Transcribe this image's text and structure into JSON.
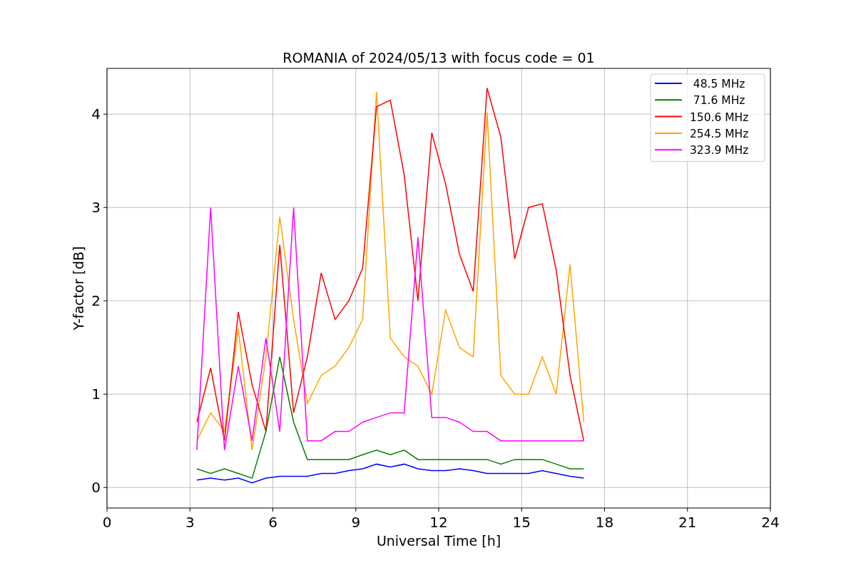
{
  "chart_data": {
    "type": "line",
    "title": "ROMANIA of 2024/05/13 with focus code = 01",
    "xlabel": "Universal Time [h]",
    "ylabel": "Y-factor [dB]",
    "xlim": [
      0,
      24
    ],
    "ylim": [
      -0.22,
      4.49
    ],
    "xticks": [
      0,
      3,
      6,
      9,
      12,
      15,
      18,
      21,
      24
    ],
    "yticks": [
      0,
      1,
      2,
      3,
      4
    ],
    "grid": true,
    "legend": true,
    "x": [
      3.25,
      3.75,
      4.25,
      4.75,
      5.25,
      5.75,
      6.25,
      6.75,
      7.25,
      7.75,
      8.25,
      8.75,
      9.25,
      9.75,
      10.25,
      10.75,
      11.25,
      11.75,
      12.25,
      12.75,
      13.25,
      13.75,
      14.25,
      14.75,
      15.25,
      15.75,
      16.25,
      16.75,
      17.25
    ],
    "series": [
      {
        "name": "  48.5 MHz",
        "color": "#0000ff",
        "values": [
          0.08,
          0.1,
          0.08,
          0.1,
          0.05,
          0.1,
          0.12,
          0.12,
          0.12,
          0.15,
          0.15,
          0.18,
          0.2,
          0.25,
          0.22,
          0.25,
          0.2,
          0.18,
          0.18,
          0.2,
          0.18,
          0.15,
          0.15,
          0.15,
          0.15,
          0.18,
          0.15,
          0.12,
          0.1
        ]
      },
      {
        "name": "  71.6 MHz",
        "color": "#008000",
        "values": [
          0.2,
          0.15,
          0.2,
          0.15,
          0.1,
          0.6,
          1.4,
          0.7,
          0.3,
          0.3,
          0.3,
          0.3,
          0.35,
          0.4,
          0.35,
          0.4,
          0.3,
          0.3,
          0.3,
          0.3,
          0.3,
          0.3,
          0.25,
          0.3,
          0.3,
          0.3,
          0.25,
          0.2,
          0.2
        ]
      },
      {
        "name": " 150.6 MHz",
        "color": "#ff0000",
        "values": [
          0.7,
          1.28,
          0.5,
          1.88,
          1.1,
          0.6,
          2.6,
          0.8,
          1.4,
          2.3,
          1.8,
          2.0,
          2.35,
          4.08,
          4.15,
          3.35,
          2.0,
          3.8,
          3.25,
          2.5,
          2.1,
          4.28,
          3.75,
          2.45,
          3.0,
          3.04,
          2.33,
          1.2,
          0.5
        ]
      },
      {
        "name": " 254.5 MHz",
        "color": "#ffa500",
        "values": [
          0.5,
          0.8,
          0.6,
          1.7,
          0.4,
          1.4,
          2.9,
          1.8,
          0.9,
          1.2,
          1.3,
          1.5,
          1.8,
          4.24,
          1.6,
          1.4,
          1.3,
          1.0,
          1.9,
          1.5,
          1.4,
          4.02,
          1.2,
          1.0,
          1.0,
          1.4,
          1.0,
          2.39,
          0.7
        ]
      },
      {
        "name": " 323.9 MHz",
        "color": "#ff00ff",
        "values": [
          0.4,
          3.0,
          0.4,
          1.3,
          0.5,
          1.6,
          0.6,
          3.0,
          0.5,
          0.5,
          0.6,
          0.6,
          0.7,
          0.75,
          0.8,
          0.8,
          2.68,
          0.75,
          0.75,
          0.7,
          0.6,
          0.6,
          0.5,
          0.5,
          0.5,
          0.5,
          0.5,
          0.5,
          0.5
        ]
      }
    ]
  }
}
